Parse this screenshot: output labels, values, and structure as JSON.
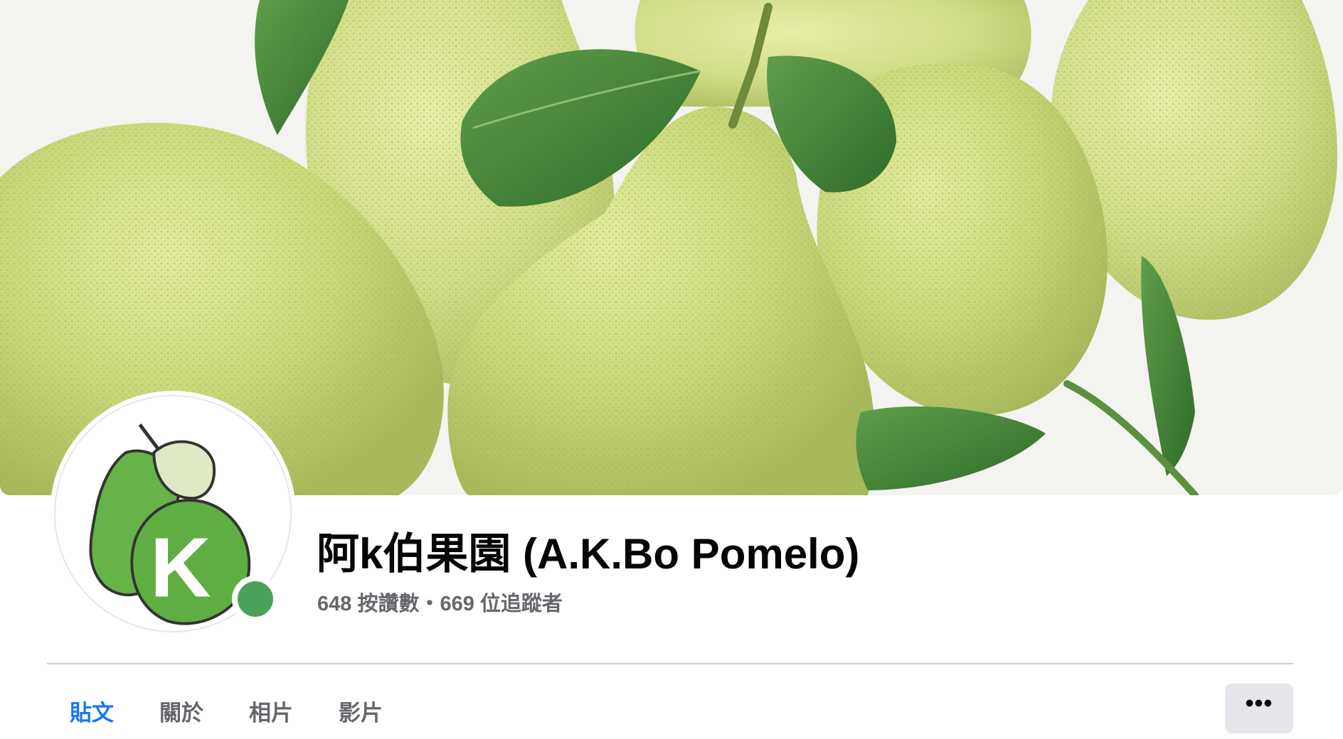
{
  "page": {
    "name": "阿k伯果園 (A.K.Bo Pomelo)",
    "stats": "648 按讚數・669 位追蹤者",
    "avatar_letter": "K",
    "online": true
  },
  "tabs": [
    {
      "label": "貼文",
      "active": true
    },
    {
      "label": "關於",
      "active": false
    },
    {
      "label": "相片",
      "active": false
    },
    {
      "label": "影片",
      "active": false
    }
  ],
  "more_button": {
    "icon": "more-horizontal-icon",
    "glyph": "•••"
  },
  "cover": {
    "subject": "pomelos-with-leaves"
  },
  "colors": {
    "accent": "#1877f2",
    "online": "#4aa259",
    "text_primary": "#050505",
    "text_secondary": "#65676b",
    "divider": "#ced0d4",
    "button_bg": "#e4e6eb"
  }
}
